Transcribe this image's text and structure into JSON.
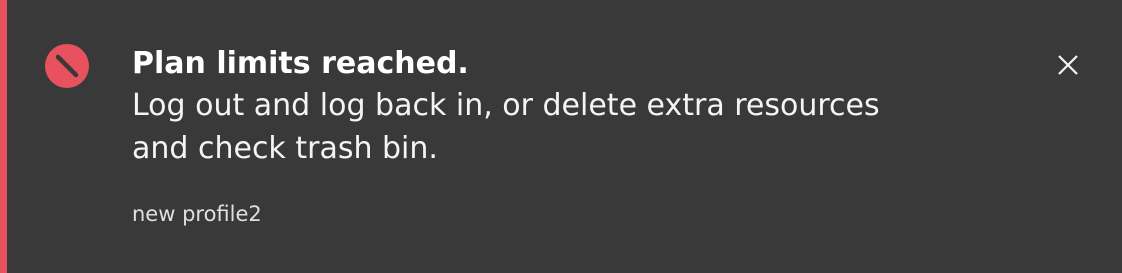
{
  "notification": {
    "kind": "error",
    "title": "Plan limits reached.",
    "message": "Log out and log back in, or delete extra resources and check trash bin.",
    "caption": "new profile2",
    "icon": "error-icon",
    "close_icon": "close-icon",
    "colors": {
      "background": "#393939",
      "accent": "#e8525e",
      "text": "#f4f4f4"
    }
  }
}
